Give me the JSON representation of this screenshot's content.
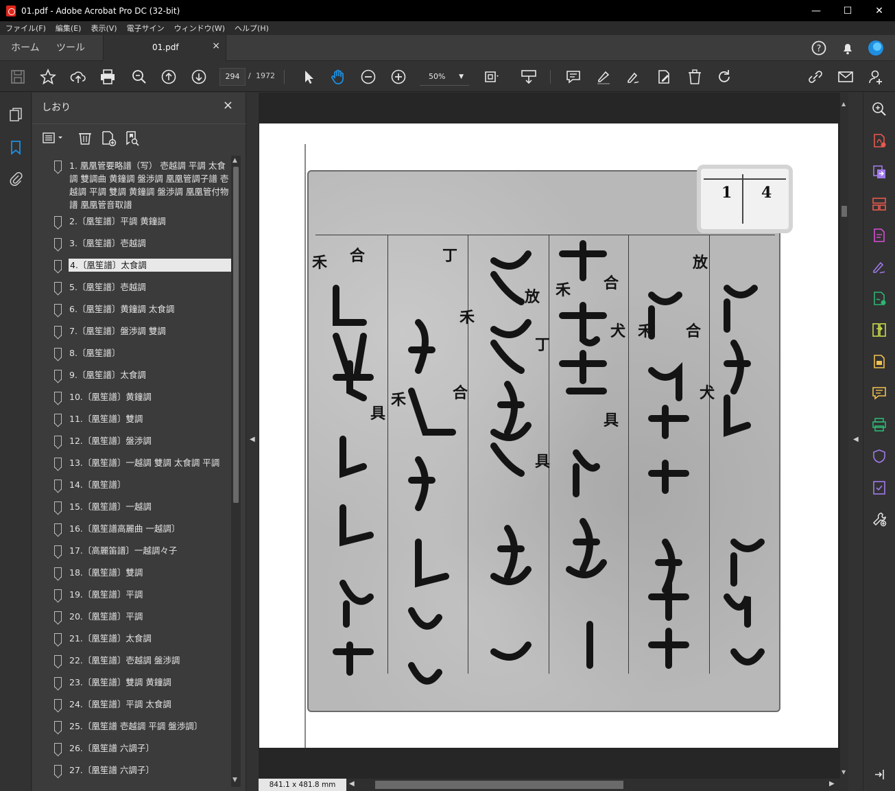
{
  "window": {
    "title": "01.pdf - Adobe Acrobat Pro DC (32-bit)",
    "minimize": "—",
    "maximize": "☐",
    "close": "✕"
  },
  "menu": [
    "ファイル(F)",
    "編集(E)",
    "表示(V)",
    "電子サイン",
    "ウィンドウ(W)",
    "ヘルプ(H)"
  ],
  "tabs": {
    "home": "ホーム",
    "tools": "ツール",
    "doc": "01.pdf",
    "doc_close": "×"
  },
  "toolbar": {
    "page_current": "294",
    "page_sep": "/",
    "page_total": "1972",
    "zoom": "50%"
  },
  "bookmarks": {
    "title": "しおり",
    "close": "×",
    "items": [
      "1. 凰凰管要略譜（写） 壱越調 平調 太食調 雙調曲 黄鐘調 盤渉調 凰凰管調子譜 壱越調 平調 雙調 黄鐘調 盤渉調 凰凰管付物譜 凰凰管音取譜",
      "2.〔凰笙譜〕平調 黄鐘調",
      "3.〔凰笙譜〕壱越調",
      "4.〔凰笙譜〕太食調",
      "5.〔凰笙譜〕壱越調",
      "6.〔凰笙譜〕黄鐘調 太食調",
      "7.〔凰笙譜〕盤渉調 雙調",
      "8.〔凰笙譜〕",
      "9.〔凰笙譜〕太食調",
      "10.〔凰笙譜〕黄鐘調",
      "11.〔凰笙譜〕雙調",
      "12.〔凰笙譜〕盤渉調",
      "13.〔凰笙譜〕一越調 雙調 太食調 平調",
      "14.〔凰笙譜〕",
      "15.〔凰笙譜〕一越調",
      "16.〔凰笙譜高麗曲 一越調〕",
      "17.〔高麗笛譜〕一越調々子",
      "18.〔凰笙譜〕雙調",
      "19.〔凰笙譜〕平調",
      "20.〔凰笙譜〕平調",
      "21.〔凰笙譜〕太食調",
      "22.〔凰笙譜〕壱越調 盤渉調",
      "23.〔凰笙譜〕雙調 黄鐘調",
      "24.〔凰笙譜〕平調 太食調",
      "25.〔凰笙譜 壱越調 平調 盤渉調〕",
      "26.〔凰笙譜 六調子〕",
      "27.〔凰笙譜 六調子〕"
    ],
    "selected_index": 3
  },
  "document": {
    "stamp_left": "1",
    "stamp_right": "4",
    "page_size": "841.1 x 481.8 mm"
  },
  "colors": {
    "accent_blue": "#1e8fe0",
    "selected_bm": "#e8e8e8"
  }
}
